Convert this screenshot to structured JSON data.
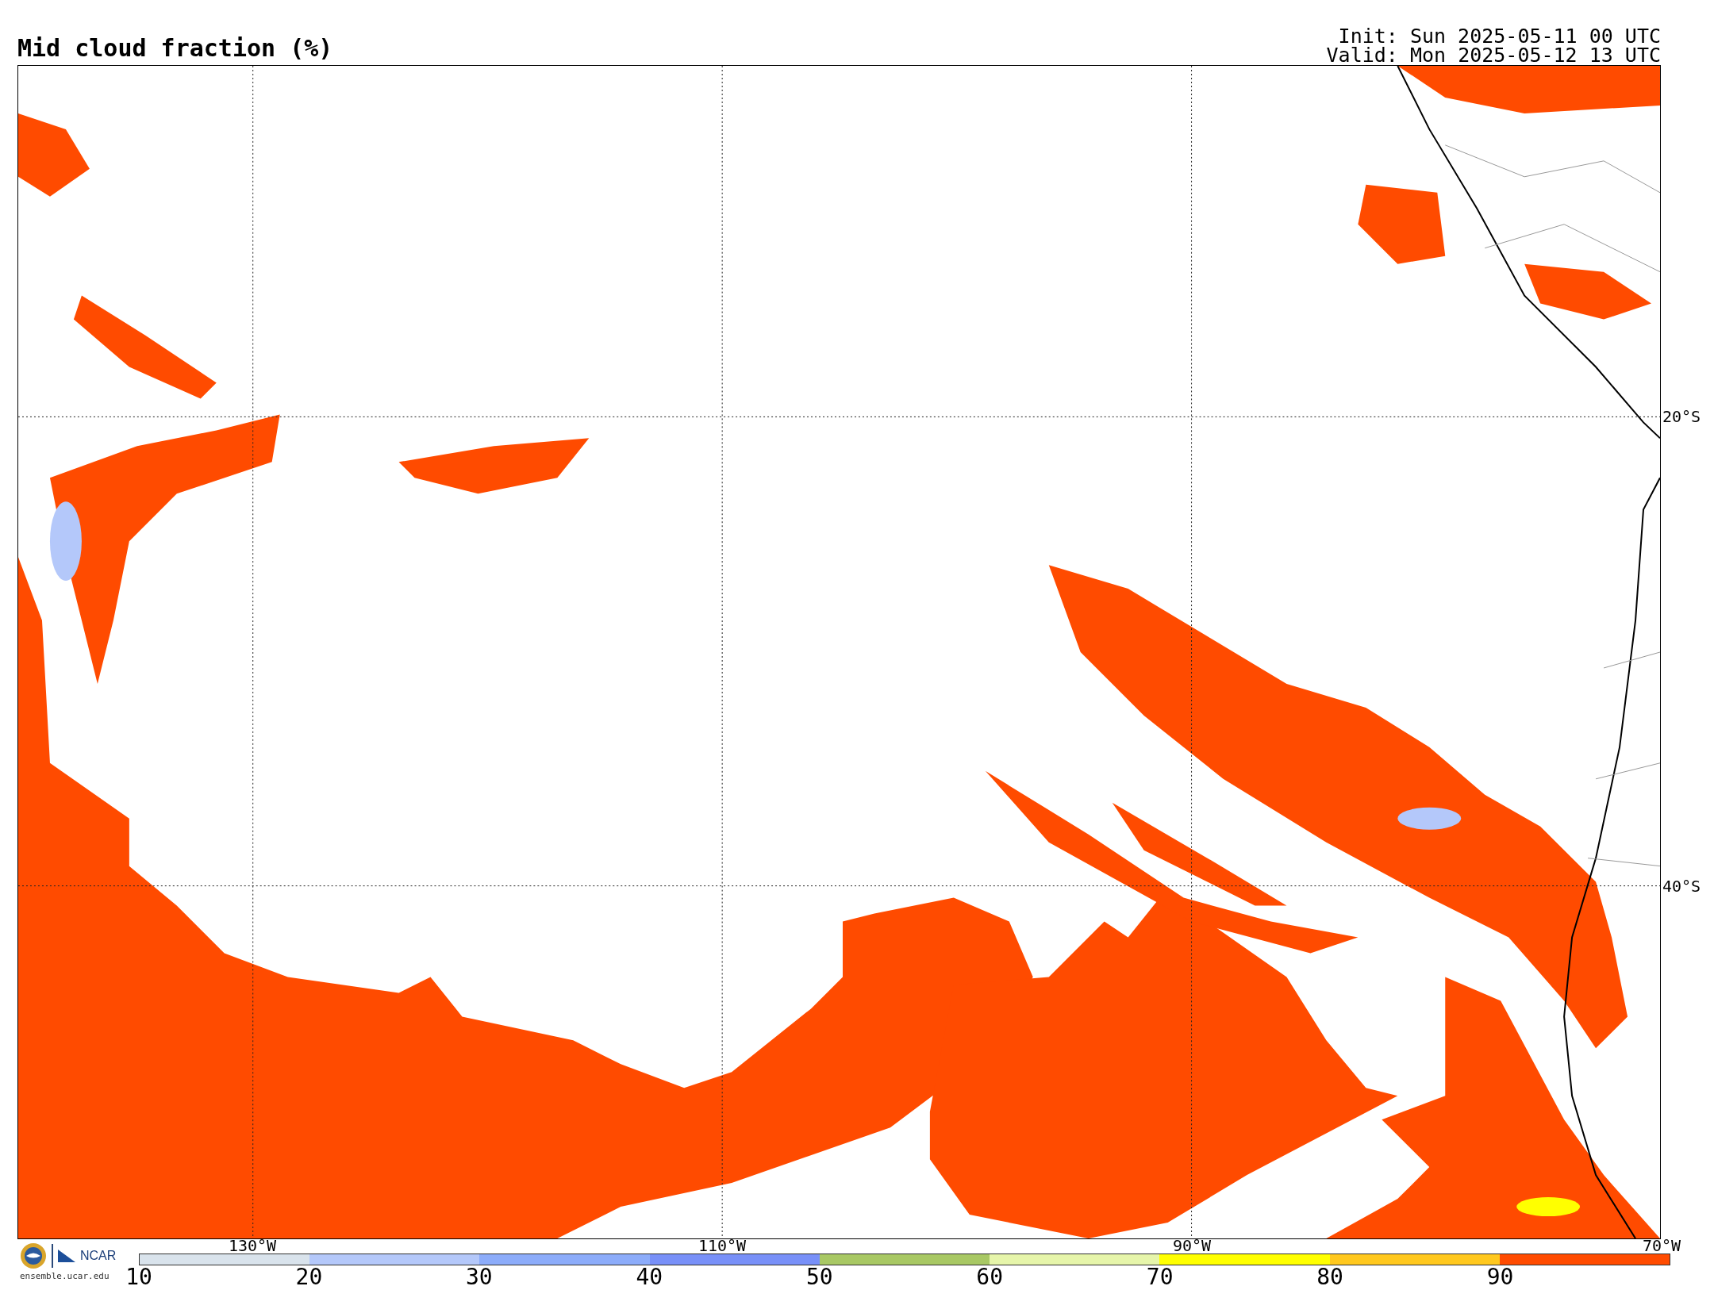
{
  "title": "Mid cloud fraction (%)",
  "run_info": [
    "Init: Sun 2025-05-11 00 UTC",
    "Valid: Mon 2025-05-12 13 UTC"
  ],
  "map": {
    "lat_labels": [
      "20°S",
      "40°S"
    ],
    "lon_labels": [
      "130°W",
      "110°W",
      "90°W",
      "70°W"
    ]
  },
  "logo": {
    "name": "NCAR",
    "url": "ensemble.ucar.edu"
  },
  "colorbar": {
    "ticks": [
      "10",
      "20",
      "30",
      "40",
      "50",
      "60",
      "70",
      "80",
      "90"
    ],
    "segments": [
      {
        "color": "#d9e3ec"
      },
      {
        "color": "#b4c8fa"
      },
      {
        "color": "#8cacfa"
      },
      {
        "color": "#7890f8"
      },
      {
        "color": "#a8c864"
      },
      {
        "color": "#e6f5aa"
      },
      {
        "color": "#ffff00"
      },
      {
        "color": "#ffc81e"
      },
      {
        "color": "#ff4b00"
      }
    ]
  }
}
